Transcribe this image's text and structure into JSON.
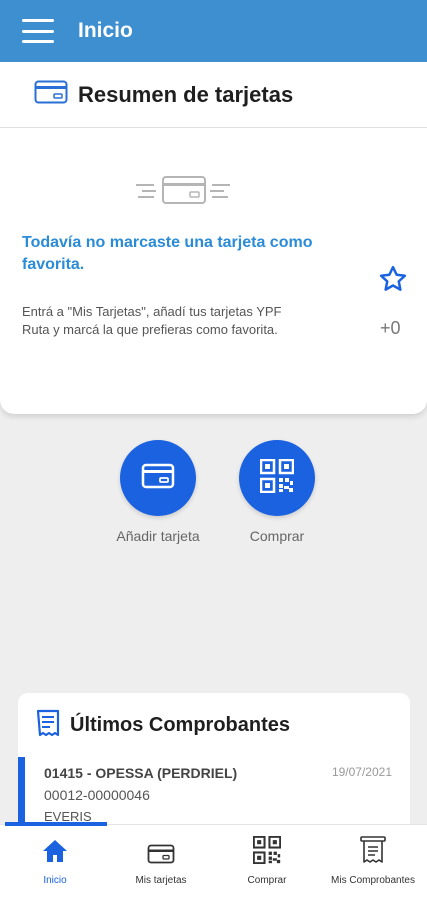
{
  "appbar": {
    "title": "Inicio"
  },
  "summary": {
    "title": "Resumen de tarjetas"
  },
  "favorite": {
    "headline": "Todavía no marcaste una tarjeta como favorita.",
    "body": "Entrá a \"Mis Tarjetas\", añadí tus tarjetas YPF Ruta y marcá la que prefieras como favorita.",
    "count": "+0"
  },
  "actions": {
    "add_card": "Añadir tarjeta",
    "buy": "Comprar"
  },
  "receipts": {
    "title": "Últimos Comprobantes",
    "items": [
      {
        "station": "01415 - OPESSA (PERDRIEL)",
        "date": "19/07/2021",
        "number": "00012-00000046",
        "company": "EVERIS"
      }
    ]
  },
  "nav": {
    "items": [
      {
        "label": "Inicio",
        "icon": "home-icon"
      },
      {
        "label": "Mis tarjetas",
        "icon": "card-icon"
      },
      {
        "label": "Comprar",
        "icon": "qr-icon"
      },
      {
        "label": "Mis Comprobantes",
        "icon": "receipt-icon"
      }
    ],
    "active_index": 0
  },
  "colors": {
    "appbar": "#3d8fd0",
    "accent": "#1b62e0",
    "headline": "#2a8bd6"
  }
}
